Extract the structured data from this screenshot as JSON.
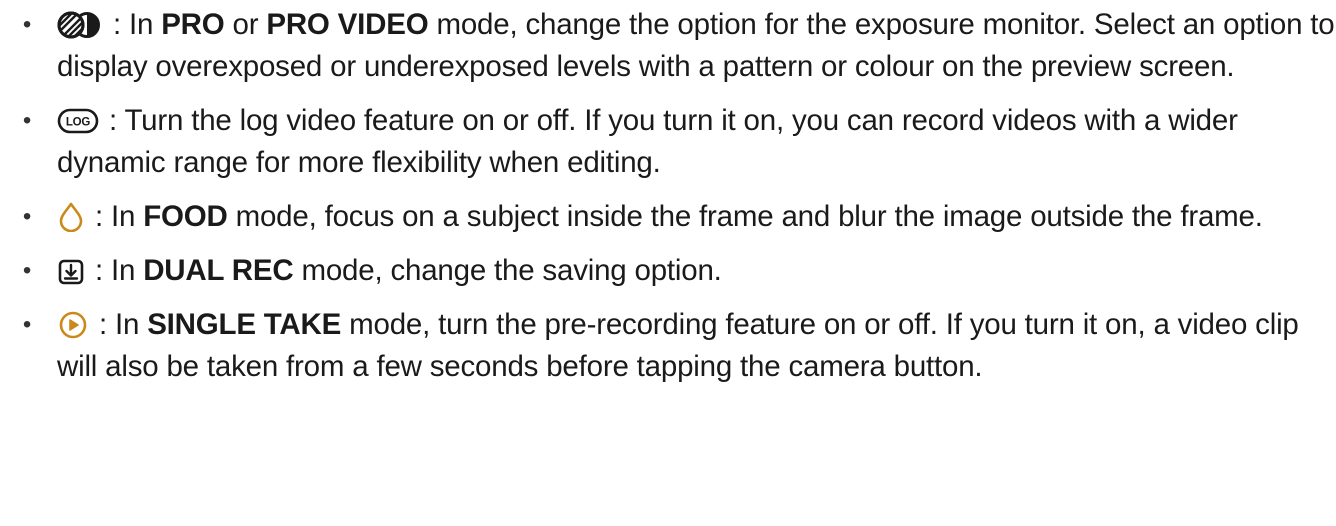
{
  "bullet": "•",
  "items": [
    {
      "icon": "exposure-monitor-icon",
      "parts": [
        " : In ",
        "PRO",
        " or ",
        "PRO VIDEO",
        " mode, change the option for the exposure monitor. Select an option to display overexposed or underexposed levels with a pattern or colour on the preview screen."
      ]
    },
    {
      "icon": "log-video-icon",
      "icon_text": "LOG",
      "parts": [
        " : Turn the log video feature on or off. If you turn it on, you can record videos with a wider dynamic range for more flexibility when editing."
      ]
    },
    {
      "icon": "food-focus-drop-icon",
      "icon_color": "#c98a1b",
      "parts": [
        " : In ",
        "FOOD",
        " mode, focus on a subject inside the frame and blur the image outside the frame."
      ]
    },
    {
      "icon": "save-option-icon",
      "parts": [
        " : In ",
        "DUAL REC",
        " mode, change the saving option."
      ]
    },
    {
      "icon": "pre-recording-play-icon",
      "icon_color": "#c98a1b",
      "parts": [
        " : In ",
        "SINGLE TAKE",
        " mode, turn the pre-recording feature on or off. If you turn it on, a video clip will also be taken from a few seconds before tapping the camera button."
      ]
    }
  ]
}
